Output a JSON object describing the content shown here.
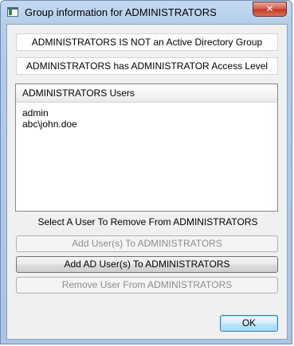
{
  "window": {
    "title": "Group information for ADMINISTRATORS",
    "close_glyph": "✕"
  },
  "info": {
    "ad_status": "ADMINISTRATORS IS NOT an Active Directory Group",
    "access_level": "ADMINISTRATORS has ADMINISTRATOR Access Level"
  },
  "users_list": {
    "header": "ADMINISTRATORS Users",
    "items": [
      "admin",
      "abc\\john.doe"
    ]
  },
  "instruction": "Select A User To Remove From ADMINISTRATORS",
  "buttons": {
    "add_users": {
      "label": "Add User(s) To ADMINISTRATORS",
      "enabled": false
    },
    "add_ad_users": {
      "label": "Add AD User(s) To ADMINISTRATORS",
      "enabled": true
    },
    "remove_user": {
      "label": "Remove User From ADMINISTRATORS",
      "enabled": false
    },
    "ok": {
      "label": "OK"
    }
  },
  "icons": {
    "app": "app-window-icon",
    "close": "close-icon"
  }
}
